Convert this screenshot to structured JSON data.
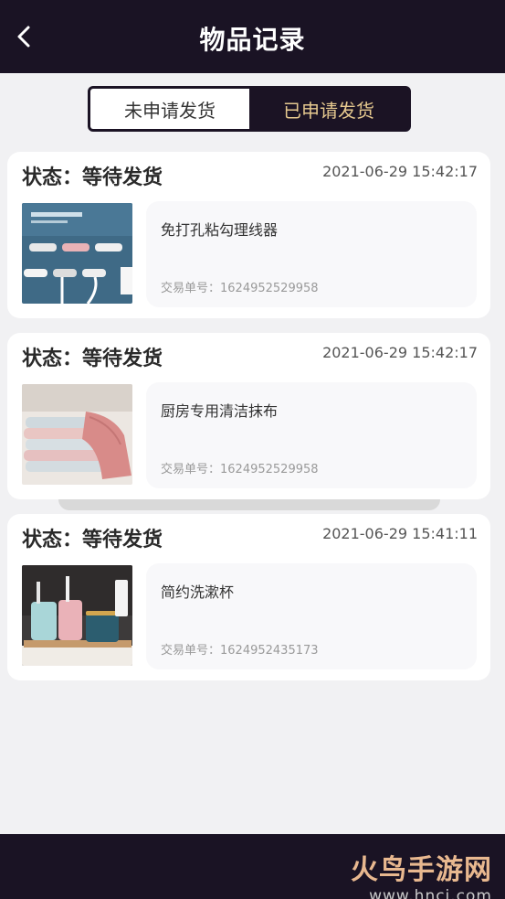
{
  "header": {
    "title": "物品记录",
    "back_icon": "chevron-left-icon"
  },
  "tabs": [
    {
      "label": "未申请发货",
      "active": false
    },
    {
      "label": "已申请发货",
      "active": true
    }
  ],
  "records": [
    {
      "status": "状态：等待发货",
      "time": "2021-06-29 15:42:17",
      "product_name": "免打孔粘勾理线器",
      "order": "交易单号：1624952529958",
      "image": "cable-organizer-photo"
    },
    {
      "status": "状态：等待发货",
      "time": "2021-06-29 15:42:17",
      "product_name": "厨房专用清洁抹布",
      "order": "交易单号：1624952529958",
      "image": "cleaning-cloth-photo"
    },
    {
      "status": "状态：等待发货",
      "time": "2021-06-29 15:41:11",
      "product_name": "简约洗漱杯",
      "order": "交易单号：1624952435173",
      "image": "toothbrush-cup-photo"
    }
  ],
  "watermark": {
    "logo": "火鸟手游网",
    "url": "www.hncj.com"
  },
  "colors": {
    "header_bg": "#1a1324",
    "active_tab_text": "#e6c98f",
    "page_bg": "#f1f1f3"
  }
}
